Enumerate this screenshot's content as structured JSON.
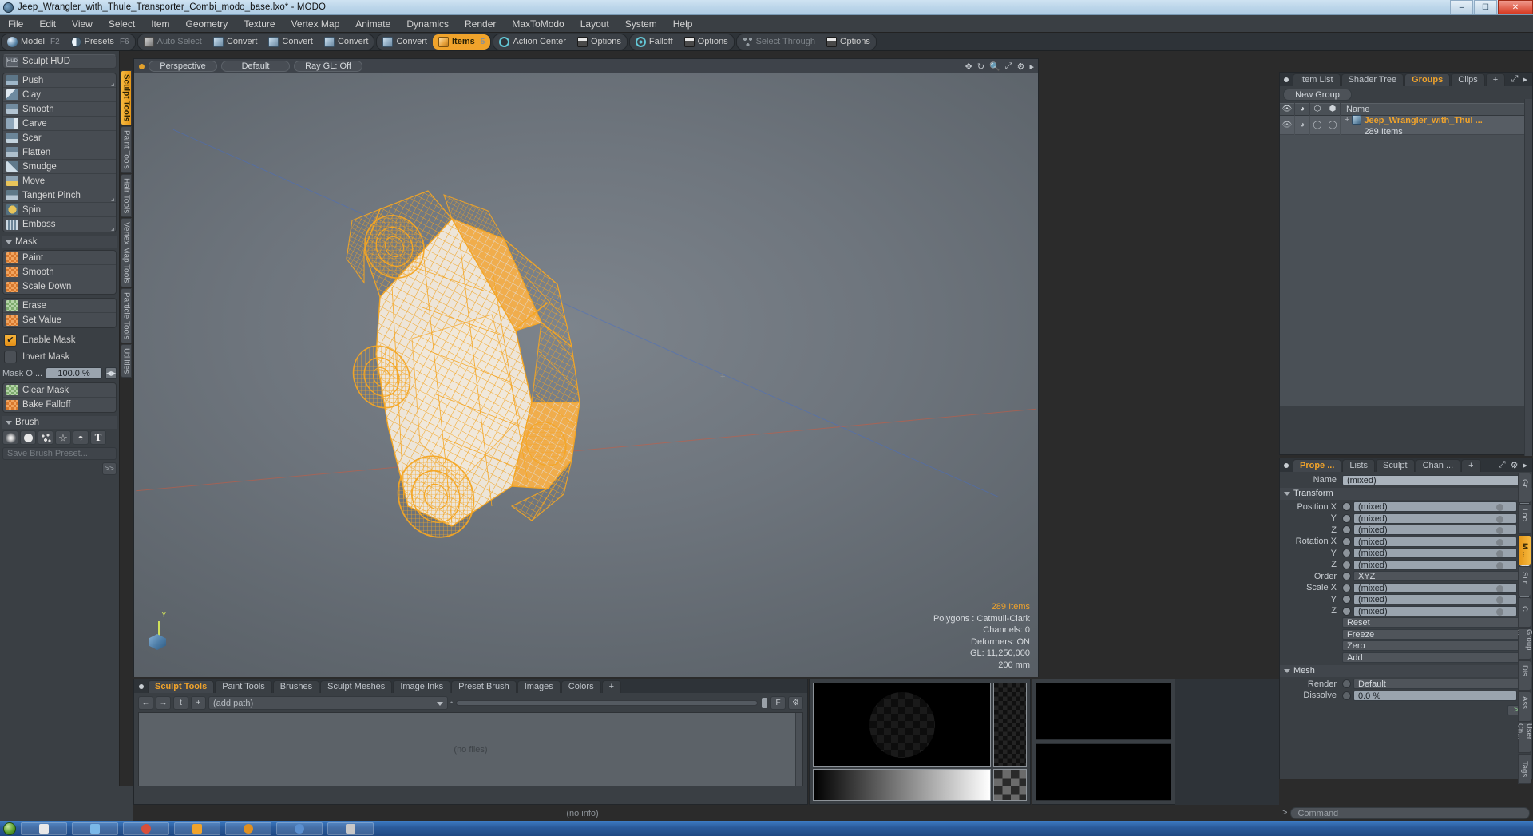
{
  "titlebar": {
    "title": "Jeep_Wrangler_with_Thule_Transporter_Combi_modo_base.lxo* - MODO",
    "minimize": "–",
    "maximize": "☐",
    "close": "✕"
  },
  "menubar": {
    "items": [
      "File",
      "Edit",
      "View",
      "Select",
      "Item",
      "Geometry",
      "Texture",
      "Vertex Map",
      "Animate",
      "Dynamics",
      "Render",
      "MaxToModo",
      "Layout",
      "System",
      "Help"
    ]
  },
  "toolbar": {
    "groups": [
      {
        "buttons": [
          {
            "label": "Model",
            "key": "F2",
            "icon": "sphere-icon",
            "state": "normal"
          },
          {
            "label": "Presets",
            "key": "F6",
            "icon": "half-sphere-icon",
            "state": "normal"
          }
        ]
      },
      {
        "buttons": [
          {
            "label": "Auto Select",
            "key": "",
            "icon": "cube-grey-icon",
            "state": "dim"
          },
          {
            "label": "Convert",
            "key": "",
            "icon": "cube-icon",
            "state": "normal"
          },
          {
            "label": "Convert",
            "key": "",
            "icon": "cube-icon",
            "state": "normal"
          },
          {
            "label": "Convert",
            "key": "",
            "icon": "cube-icon",
            "state": "normal"
          }
        ]
      },
      {
        "buttons": [
          {
            "label": "Convert",
            "key": "",
            "icon": "cube-icon",
            "state": "normal"
          },
          {
            "label": "Items",
            "key": "5",
            "icon": "cube-orange-icon",
            "state": "active"
          }
        ]
      },
      {
        "buttons": [
          {
            "label": "Action Center",
            "key": "",
            "icon": "action-center-icon",
            "state": "normal"
          },
          {
            "label": "Options",
            "key": "",
            "icon": "panel-icon",
            "state": "normal"
          }
        ]
      },
      {
        "buttons": [
          {
            "label": "Falloff",
            "key": "",
            "icon": "falloff-ring-icon",
            "state": "normal"
          },
          {
            "label": "Options",
            "key": "",
            "icon": "panel-icon",
            "state": "normal"
          }
        ]
      },
      {
        "buttons": [
          {
            "label": "Select Through",
            "key": "",
            "icon": "nodes-icon",
            "state": "dim"
          },
          {
            "label": "Options",
            "key": "",
            "icon": "panel-icon",
            "state": "normal"
          }
        ]
      }
    ]
  },
  "left_panel": {
    "hud": {
      "label": "Sculpt HUD",
      "icon": "hud-icon"
    },
    "sculpt_tools": [
      {
        "label": "Push",
        "icon": "push-icon",
        "has_corner": true
      },
      {
        "label": "Clay",
        "icon": "clay-icon",
        "has_corner": false
      },
      {
        "label": "Smooth",
        "icon": "smooth-icon",
        "has_corner": false
      },
      {
        "label": "Carve",
        "icon": "carve-icon",
        "has_corner": false
      },
      {
        "label": "Scar",
        "icon": "scar-icon",
        "has_corner": false
      },
      {
        "label": "Flatten",
        "icon": "flatten-icon",
        "has_corner": false
      },
      {
        "label": "Smudge",
        "icon": "smudge-icon",
        "has_corner": false
      },
      {
        "label": "Move",
        "icon": "move-icon",
        "has_corner": false
      },
      {
        "label": "Tangent Pinch",
        "icon": "tangent-pinch-icon",
        "has_corner": true
      },
      {
        "label": "Spin",
        "icon": "spin-icon",
        "has_corner": false
      },
      {
        "label": "Emboss",
        "icon": "emboss-icon",
        "has_corner": true
      }
    ],
    "mask_section_label": "Mask",
    "mask_tools": [
      {
        "label": "Paint",
        "icon": "mask-paint-icon"
      },
      {
        "label": "Smooth",
        "icon": "mask-smooth-icon"
      },
      {
        "label": "Scale Down",
        "icon": "mask-scale-down-icon"
      }
    ],
    "mask_tools2": [
      {
        "label": "Erase",
        "icon": "mask-erase-icon"
      },
      {
        "label": "Set Value",
        "icon": "mask-set-value-icon"
      }
    ],
    "enable_mask": {
      "label": "Enable Mask",
      "checked": true,
      "glyph": "✔"
    },
    "invert_mask": {
      "label": "Invert Mask",
      "checked": false,
      "glyph": ""
    },
    "mask_opacity": {
      "label": "Mask O ...",
      "value": "100.0 %"
    },
    "mask_tools3": [
      {
        "label": "Clear Mask",
        "icon": "mask-clear-icon"
      },
      {
        "label": "Bake Falloff",
        "icon": "mask-bake-falloff-icon"
      }
    ],
    "brush_section_label": "Brush",
    "brush_icons": [
      "brush-soft-icon",
      "brush-hard-icon",
      "brush-spray-icon",
      "brush-star-icon",
      "brush-procedural-icon",
      "brush-text-icon"
    ],
    "save_brush_preset": "Save Brush Preset...",
    "expand_label": ">>"
  },
  "vertical_tabs": [
    {
      "label": "Sculpt Tools",
      "active": true
    },
    {
      "label": "Paint Tools",
      "active": false
    },
    {
      "label": "Hair Tools",
      "active": false
    },
    {
      "label": "Vertex Map Tools",
      "active": false
    },
    {
      "label": "Particle Tools",
      "active": false
    },
    {
      "label": "Utilities",
      "active": false
    }
  ],
  "viewport": {
    "pills": [
      "Perspective",
      "Default",
      "Ray GL: Off"
    ],
    "icons": [
      "move-view-icon",
      "rotate-view-icon",
      "zoom-view-icon",
      "fit-view-icon",
      "gear-icon",
      "chevron-right-icon"
    ],
    "hud": {
      "items": "289 Items",
      "polygons": "Polygons : Catmull-Clark",
      "channels": "Channels: 0",
      "deformers": "Deformers: ON",
      "gl": "GL: 11,250,000",
      "scale": "200 mm"
    },
    "gizmo_axis": "Y",
    "center_marker": "+",
    "model_color": "#f5a623",
    "model_name": "jeep-wrangler-wireframe"
  },
  "bottom_panel": {
    "tabs": [
      {
        "label": "Sculpt Tools",
        "active": true
      },
      {
        "label": "Paint Tools",
        "active": false
      },
      {
        "label": "Brushes",
        "active": false
      },
      {
        "label": "Sculpt Meshes",
        "active": false
      },
      {
        "label": "Image Inks",
        "active": false
      },
      {
        "label": "Preset Brush",
        "active": false
      },
      {
        "label": "Images",
        "active": false
      },
      {
        "label": "Colors",
        "active": false
      },
      {
        "label": "+",
        "active": false
      }
    ],
    "nav_buttons": [
      "back-icon",
      "forward-icon",
      "up-icon",
      "add-icon"
    ],
    "path_value": "(add path)",
    "flag_button": "F",
    "gear_button": "gear-icon",
    "file_area_text": "(no files)"
  },
  "right_panel": {
    "tabs": [
      {
        "label": "Item List",
        "active": false
      },
      {
        "label": "Shader Tree",
        "active": false
      },
      {
        "label": "Groups",
        "active": true
      },
      {
        "label": "Clips",
        "active": false
      },
      {
        "label": "+",
        "active": false
      }
    ],
    "tab_icons": [
      "expand-icon",
      "chevron-right-icon"
    ],
    "new_group_button": "New Group",
    "tree_columns": [
      "eye-icon",
      "render-icon",
      "wire-icon",
      "shade-icon"
    ],
    "name_column": "Name",
    "rows": [
      {
        "name": "Jeep_Wrangler_with_Thul ...",
        "sub": "289 Items",
        "plus": "+",
        "icon": "group-cube-icon"
      }
    ]
  },
  "properties": {
    "tabs": [
      {
        "label": "Prope ...",
        "active": true
      },
      {
        "label": "Lists",
        "active": false
      },
      {
        "label": "Sculpt",
        "active": false
      },
      {
        "label": "Chan ...",
        "active": false
      },
      {
        "label": "+",
        "active": false
      }
    ],
    "tab_icons": [
      "expand-icon",
      "gear-icon",
      "chevron-right-icon"
    ],
    "name_label": "Name",
    "name_value": "(mixed)",
    "transform_section": "Transform",
    "transform_rows": [
      {
        "label": "Position X",
        "value": "(mixed)"
      },
      {
        "label": "Y",
        "value": "(mixed)"
      },
      {
        "label": "Z",
        "value": "(mixed)"
      },
      {
        "label": "Rotation X",
        "value": "(mixed)"
      },
      {
        "label": "Y",
        "value": "(mixed)"
      },
      {
        "label": "Z",
        "value": "(mixed)"
      }
    ],
    "order_label": "Order",
    "order_value": "XYZ",
    "scale_rows": [
      {
        "label": "Scale X",
        "value": "(mixed)"
      },
      {
        "label": "Y",
        "value": "(mixed)"
      },
      {
        "label": "Z",
        "value": "(mixed)"
      }
    ],
    "action_dropdowns": [
      "Reset",
      "Freeze",
      "Zero",
      "Add"
    ],
    "mesh_section": "Mesh",
    "render_label": "Render",
    "render_value": "Default",
    "dissolve_label": "Dissolve",
    "dissolve_value": "0.0 %",
    "chevron_button": ">>"
  },
  "right_vertical_tabs": [
    {
      "label": "Gr ...",
      "active": false
    },
    {
      "label": "Loc ...",
      "active": false
    },
    {
      "label": "M ...",
      "active": true
    },
    {
      "label": "Sur ...",
      "active": false
    },
    {
      "label": "C ...",
      "active": false
    },
    {
      "label": "Group ...",
      "active": false
    },
    {
      "label": "Dis ...",
      "active": false
    },
    {
      "label": "Ass ...",
      "active": false
    },
    {
      "label": "User Ch...",
      "active": false
    },
    {
      "label": "Tags",
      "active": false
    }
  ],
  "command_bar": {
    "prompt": ">",
    "placeholder": "Command"
  },
  "status_bar": {
    "text": "(no info)"
  }
}
